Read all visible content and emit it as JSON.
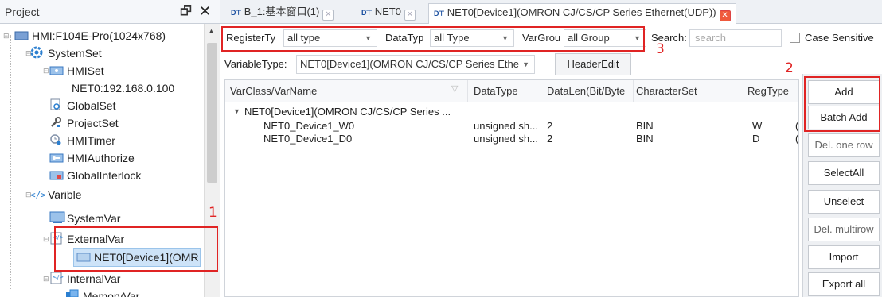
{
  "project_panel": {
    "title": "Project",
    "pin_glyph": "🗗",
    "close_glyph": "✕",
    "tree": [
      {
        "label": "HMI:F104E-Pro(1024x768)",
        "icon": "monitor-icon"
      },
      {
        "label": "SystemSet",
        "icon": "gear-icon"
      },
      {
        "label": "HMISet",
        "icon": "settings-window-icon"
      },
      {
        "label": "NET0:192.168.0.100",
        "icon": "none"
      },
      {
        "label": "GlobalSet",
        "icon": "global-settings-icon"
      },
      {
        "label": "ProjectSet",
        "icon": "wrench-icon"
      },
      {
        "label": "HMITimer",
        "icon": "timer-icon"
      },
      {
        "label": "HMIAuthorize",
        "icon": "authorize-icon"
      },
      {
        "label": "GlobalInterlock",
        "icon": "interlock-icon"
      },
      {
        "label": "Varible",
        "icon": "code-icon"
      },
      {
        "label": "SystemVar",
        "icon": "system-var-icon"
      },
      {
        "label": "ExternalVar",
        "icon": "external-var-icon"
      },
      {
        "label": "NET0[Device1](OMR",
        "icon": "device-var-icon"
      },
      {
        "label": "InternalVar",
        "icon": "internal-var-icon"
      },
      {
        "label": "MemoryVar",
        "icon": "memory-var-icon"
      }
    ]
  },
  "tabs": [
    {
      "label": "B_1:基本窗口(1)",
      "icon_text": "D⊤"
    },
    {
      "label": "NET0",
      "icon_text": "D⊤"
    },
    {
      "label": "NET0[Device1](OMRON CJ/CS/CP Series Ethernet(UDP))",
      "icon_text": "D⊤",
      "active": true
    }
  ],
  "filters": {
    "register_label": "RegisterTy",
    "register_value": "all type",
    "datatype_label": "DataTyp",
    "datatype_value": "all Type",
    "vargroup_label": "VarGrou",
    "vargroup_value": "all Group",
    "search_label": "Search:",
    "search_placeholder": "search",
    "case_sensitive_label": "Case Sensitive"
  },
  "vartype": {
    "label": "VariableType:",
    "value": "NET0[Device1](OMRON CJ/CS/CP Series Ethe",
    "header_edit_label": "HeaderEdit"
  },
  "grid": {
    "columns": [
      "VarClass/VarName",
      "DataType",
      "DataLen(Bit/Byte",
      "CharacterSet",
      "RegType"
    ],
    "group_row": "NET0[Device1](OMRON CJ/CS/CP Series ...",
    "rows": [
      {
        "name": "NET0_Device1_W0",
        "datatype": "unsigned sh...",
        "datalen": "2",
        "charset": "BIN",
        "regtype": "W",
        "extra": "("
      },
      {
        "name": "NET0_Device1_D0",
        "datatype": "unsigned sh...",
        "datalen": "2",
        "charset": "BIN",
        "regtype": "D",
        "extra": "("
      }
    ]
  },
  "side_buttons": {
    "add": "Add",
    "batch_add": "Batch Add",
    "del_one_row": "Del. one row",
    "select_all": "SelectAll",
    "unselect": "Unselect",
    "del_multirow": "Del. multirow",
    "import": "Import",
    "export_all": "Export all"
  },
  "annotations": {
    "one": "1",
    "two": "2",
    "three": "3",
    "color": "#e02424"
  }
}
